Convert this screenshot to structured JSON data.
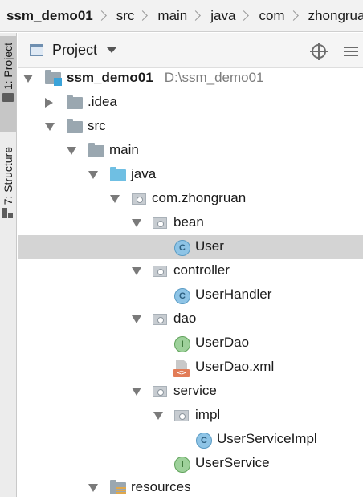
{
  "breadcrumb": [
    "ssm_demo01",
    "src",
    "main",
    "java",
    "com",
    "zhongruan"
  ],
  "tool_stripe": {
    "project_tab": "1: Project",
    "structure_tab": "7: Structure"
  },
  "panel": {
    "title": "Project",
    "locate_icon": "crosshair-icon",
    "collapse_icon": "collapse-all-icon"
  },
  "tree": {
    "root": {
      "name": "ssm_demo01",
      "path": "D:\\ssm_demo01",
      "icon": "module-folder-icon"
    },
    "idea": {
      "name": ".idea",
      "icon": "folder-icon"
    },
    "src": {
      "name": "src",
      "icon": "folder-icon"
    },
    "main": {
      "name": "main",
      "icon": "folder-icon"
    },
    "java": {
      "name": "java",
      "icon": "source-folder-icon"
    },
    "com_zhongruan": {
      "name": "com.zhongruan",
      "icon": "package-icon"
    },
    "bean": {
      "name": "bean",
      "icon": "package-icon"
    },
    "user": {
      "name": "User",
      "icon": "class-icon",
      "glyph": "C"
    },
    "controller": {
      "name": "controller",
      "icon": "package-icon"
    },
    "user_handler": {
      "name": "UserHandler",
      "icon": "class-icon",
      "glyph": "C"
    },
    "dao": {
      "name": "dao",
      "icon": "package-icon"
    },
    "user_dao": {
      "name": "UserDao",
      "icon": "interface-icon",
      "glyph": "I"
    },
    "user_dao_xml": {
      "name": "UserDao.xml",
      "icon": "xml-file-icon",
      "glyph": "<>"
    },
    "service": {
      "name": "service",
      "icon": "package-icon"
    },
    "impl": {
      "name": "impl",
      "icon": "package-icon"
    },
    "user_service_impl": {
      "name": "UserServiceImpl",
      "icon": "class-icon",
      "glyph": "C"
    },
    "user_service": {
      "name": "UserService",
      "icon": "interface-icon",
      "glyph": "I"
    },
    "resources": {
      "name": "resources",
      "icon": "resources-folder-icon"
    }
  },
  "colors": {
    "selection": "#d4d4d4",
    "class_icon": "#8ec4e6",
    "interface_icon": "#9ed19b",
    "source_folder": "#6fbfe3",
    "xml_icon": "#e27c57"
  }
}
